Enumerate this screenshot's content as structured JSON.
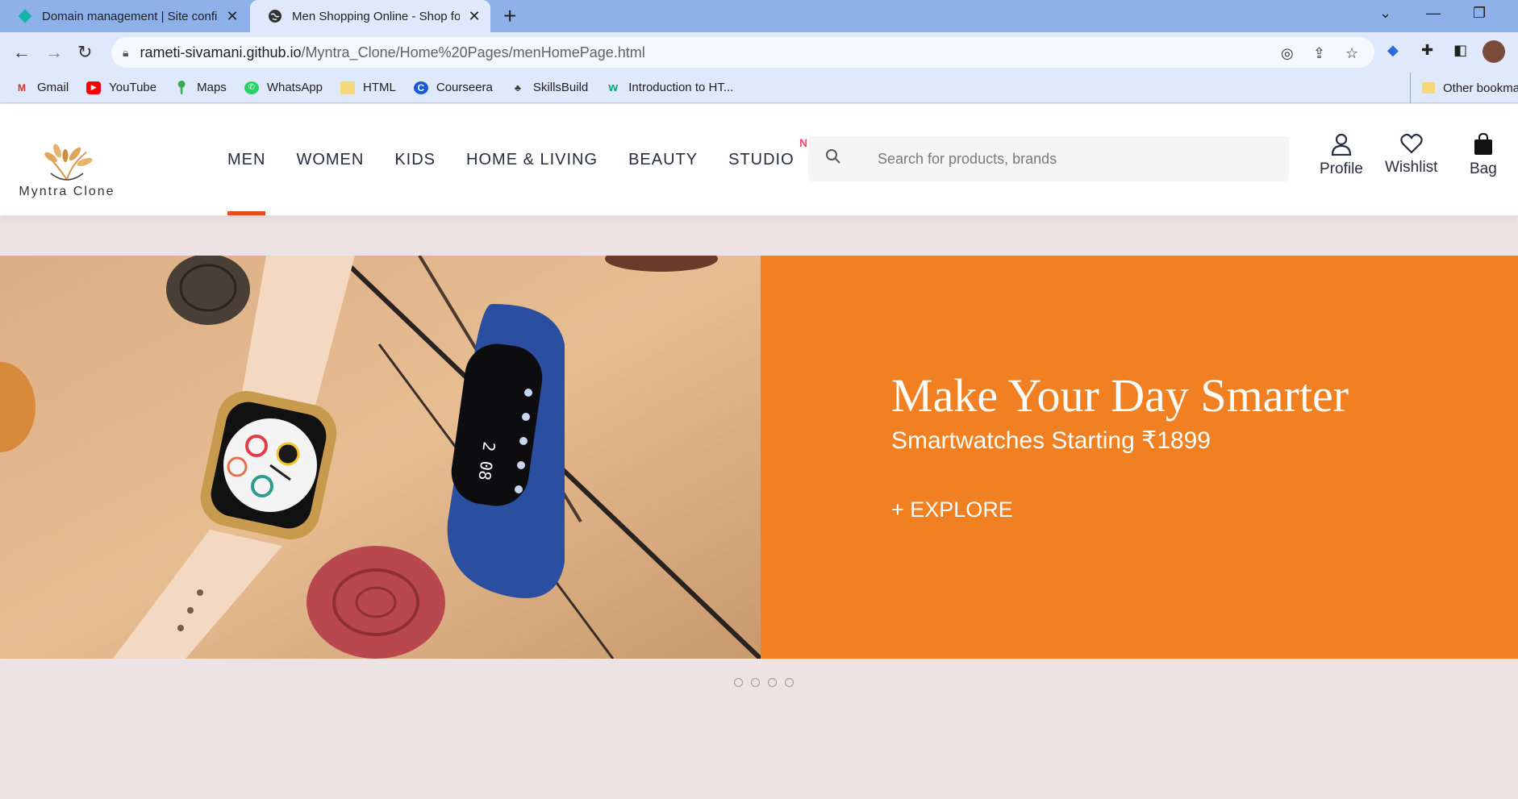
{
  "browser": {
    "tabs": [
      {
        "title": "Domain management | Site confi",
        "favicon": "netlify-icon"
      },
      {
        "title": "Men Shopping Online - Shop for",
        "favicon": "globe-icon"
      }
    ],
    "url": {
      "host": "rameti-sivamani.github.io",
      "path": "/Myntra_Clone/Home%20Pages/menHomePage.html"
    },
    "bookmarks": [
      {
        "label": "Gmail",
        "icon": "gmail-icon",
        "color": "#d93025",
        "glyph": "M"
      },
      {
        "label": "YouTube",
        "icon": "youtube-icon",
        "color": "#ff0000",
        "glyph": "▶"
      },
      {
        "label": "Maps",
        "icon": "maps-icon",
        "color": "#34a853",
        "glyph": "⬤"
      },
      {
        "label": "WhatsApp",
        "icon": "whatsapp-icon",
        "color": "#25d366",
        "glyph": "✆"
      },
      {
        "label": "HTML",
        "icon": "folder-icon",
        "color": "#f6d77a",
        "glyph": "■"
      },
      {
        "label": "Courseera",
        "icon": "coursera-icon",
        "color": "#1a56db",
        "glyph": "C"
      },
      {
        "label": "SkillsBuild",
        "icon": "skillsbuild-icon",
        "color": "#333333",
        "glyph": "♣"
      },
      {
        "label": "Introduction to HT...",
        "icon": "w3-icon",
        "color": "#04aa6d",
        "glyph": "w"
      }
    ],
    "other_bookmarks": "Other bookma"
  },
  "site": {
    "logo_text": "Myntra Clone",
    "nav": [
      {
        "label": "MEN",
        "active": true
      },
      {
        "label": "WOMEN"
      },
      {
        "label": "KIDS"
      },
      {
        "label": "HOME & LIVING"
      },
      {
        "label": "BEAUTY"
      },
      {
        "label": "STUDIO",
        "badge": "NEW"
      }
    ],
    "search_placeholder": "Search for products, brands",
    "actions": {
      "profile": "Profile",
      "wishlist": "Wishlist",
      "bag": "Bag"
    },
    "accent_color": "#e84e1b"
  },
  "banner": {
    "title": "Make Your Day Smarter",
    "subtitle": "Smartwatches Starting ₹1899",
    "cta": "+ EXPLORE",
    "background": "#f08021",
    "slide_count": 4
  }
}
